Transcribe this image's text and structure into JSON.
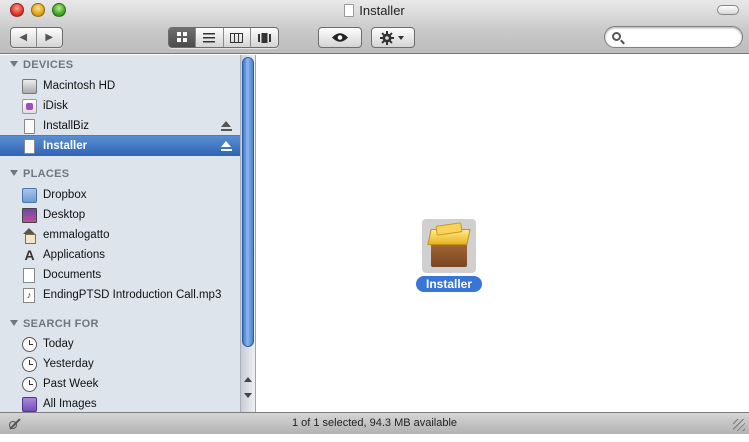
{
  "window": {
    "title": "Installer"
  },
  "toolbar": {
    "back_glyph": "◀",
    "forward_glyph": "▶",
    "view_modes": [
      "icon-view",
      "list-view",
      "column-view",
      "cover-flow"
    ],
    "active_view": "icon-view",
    "search": {
      "value": "",
      "placeholder": ""
    }
  },
  "sidebar": {
    "devices_header": "DEVICES",
    "devices": [
      {
        "label": "Macintosh HD",
        "icon": "hard-drive-icon",
        "eject": false
      },
      {
        "label": "iDisk",
        "icon": "idisk-icon",
        "eject": false
      },
      {
        "label": "InstallBiz",
        "icon": "volume-icon",
        "eject": true
      },
      {
        "label": "Installer",
        "icon": "volume-icon",
        "eject": true,
        "selected": true
      }
    ],
    "places_header": "PLACES",
    "places": [
      {
        "label": "Dropbox",
        "icon": "folder-icon"
      },
      {
        "label": "Desktop",
        "icon": "desktop-icon"
      },
      {
        "label": "emmalogatto",
        "icon": "home-icon"
      },
      {
        "label": "Applications",
        "icon": "applications-icon"
      },
      {
        "label": "Documents",
        "icon": "document-icon"
      },
      {
        "label": "EndingPTSD Introduction Call.mp3",
        "icon": "audio-file-icon"
      }
    ],
    "search_header": "SEARCH FOR",
    "searches": [
      {
        "label": "Today",
        "icon": "clock-icon"
      },
      {
        "label": "Yesterday",
        "icon": "clock-icon"
      },
      {
        "label": "Past Week",
        "icon": "clock-icon"
      },
      {
        "label": "All Images",
        "icon": "images-icon"
      }
    ]
  },
  "content": {
    "items": [
      {
        "label": "Installer",
        "icon": "package-icon",
        "selected": true
      }
    ]
  },
  "status": {
    "text": "1 of 1 selected, 94.3 MB available"
  },
  "colors": {
    "selection": "#3875d7",
    "sidebar_bg": "#dde4ec",
    "sidebar_header": "#6e7781"
  }
}
